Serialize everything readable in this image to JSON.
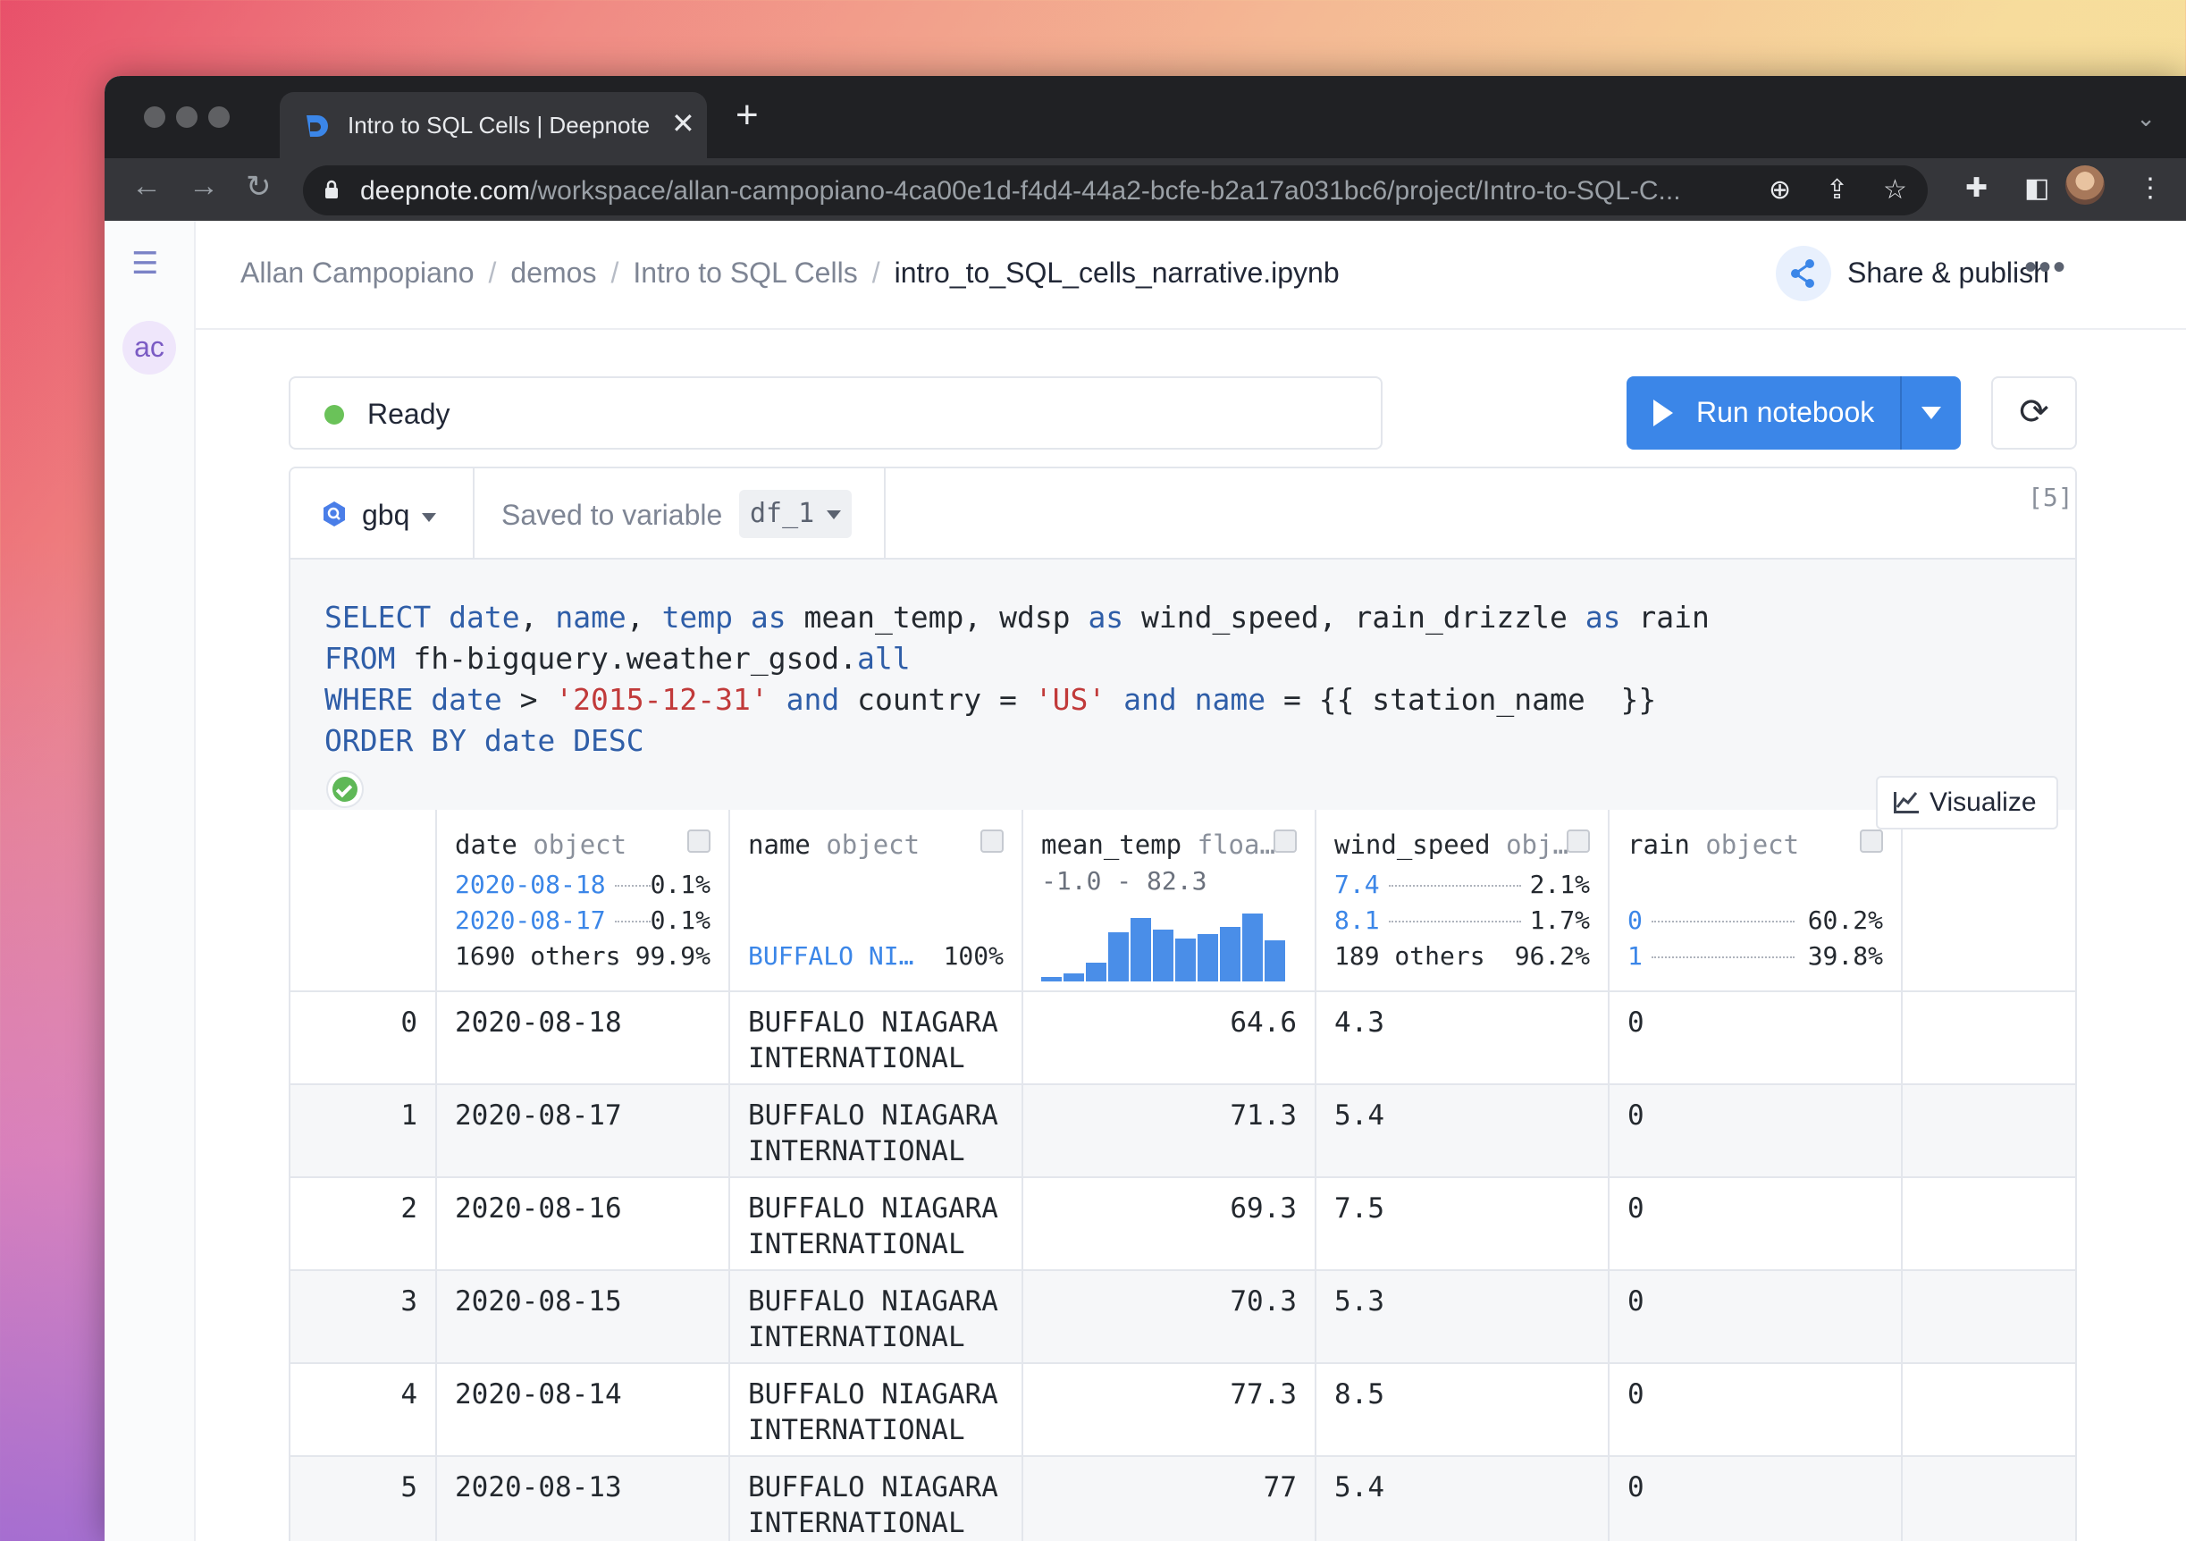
{
  "browser": {
    "tab_title": "Intro to SQL Cells | Deepnote",
    "tab_close": "✕",
    "new_tab": "+",
    "url_domain": "deepnote.com",
    "url_path": "/workspace/allan-campopiano-4ca00e1d-f4d4-44a2-bcfe-b2a17a031bc6/project/Intro-to-SQL-C..."
  },
  "sidebar": {
    "avatar_initials": "ac"
  },
  "breadcrumb": {
    "items": [
      "Allan Campopiano",
      "demos",
      "Intro to SQL Cells"
    ],
    "separator": "/",
    "current": "intro_to_SQL_cells_narrative.ipynb"
  },
  "header": {
    "share_label": "Share & publish",
    "more": "•••"
  },
  "status": {
    "text": "Ready",
    "color": "#6ac259"
  },
  "run": {
    "label": "Run notebook",
    "accent": "#3b86e8"
  },
  "cell": {
    "source": "gbq",
    "saved_label": "Saved to variable",
    "variable": "df_1",
    "exec_count": "[5]",
    "visualize_label": "Visualize"
  },
  "table": {
    "columns": [
      {
        "name": "date",
        "type": "object",
        "stats": [
          {
            "value": "2020-08-18",
            "pct": "0.1%"
          },
          {
            "value": "2020-08-17",
            "pct": "0.1%"
          }
        ],
        "others": "1690 others",
        "others_pct": "99.9%"
      },
      {
        "name": "name",
        "type": "object",
        "top_value": "BUFFALO NI…",
        "top_pct": "100%"
      },
      {
        "name": "mean_temp",
        "type": "floa…",
        "range": "-1.0 - 82.3",
        "histogram": [
          0.06,
          0.12,
          0.28,
          0.72,
          0.93,
          0.76,
          0.63,
          0.7,
          0.8,
          1.0,
          0.6
        ]
      },
      {
        "name": "wind_speed",
        "type": "obj…",
        "stats": [
          {
            "value": "7.4",
            "pct": "2.1%"
          },
          {
            "value": "8.1",
            "pct": "1.7%"
          }
        ],
        "others": "189 others",
        "others_pct": "96.2%"
      },
      {
        "name": "rain",
        "type": "object",
        "stats": [
          {
            "value": "0",
            "pct": "60.2%"
          },
          {
            "value": "1",
            "pct": "39.8%"
          }
        ]
      }
    ],
    "rows": [
      {
        "idx": "0",
        "date": "2020-08-18",
        "name": "BUFFALO NIAGARA\nINTERNATIONAL",
        "mean_temp": "64.6",
        "wind_speed": "4.3",
        "rain": "0"
      },
      {
        "idx": "1",
        "date": "2020-08-17",
        "name": "BUFFALO NIAGARA\nINTERNATIONAL",
        "mean_temp": "71.3",
        "wind_speed": "5.4",
        "rain": "0"
      },
      {
        "idx": "2",
        "date": "2020-08-16",
        "name": "BUFFALO NIAGARA\nINTERNATIONAL",
        "mean_temp": "69.3",
        "wind_speed": "7.5",
        "rain": "0"
      },
      {
        "idx": "3",
        "date": "2020-08-15",
        "name": "BUFFALO NIAGARA\nINTERNATIONAL",
        "mean_temp": "70.3",
        "wind_speed": "5.3",
        "rain": "0"
      },
      {
        "idx": "4",
        "date": "2020-08-14",
        "name": "BUFFALO NIAGARA\nINTERNATIONAL",
        "mean_temp": "77.3",
        "wind_speed": "8.5",
        "rain": "0"
      },
      {
        "idx": "5",
        "date": "2020-08-13",
        "name": "BUFFALO NIAGARA\nINTERNATIONAL",
        "mean_temp": "77",
        "wind_speed": "5.4",
        "rain": "0"
      }
    ]
  }
}
